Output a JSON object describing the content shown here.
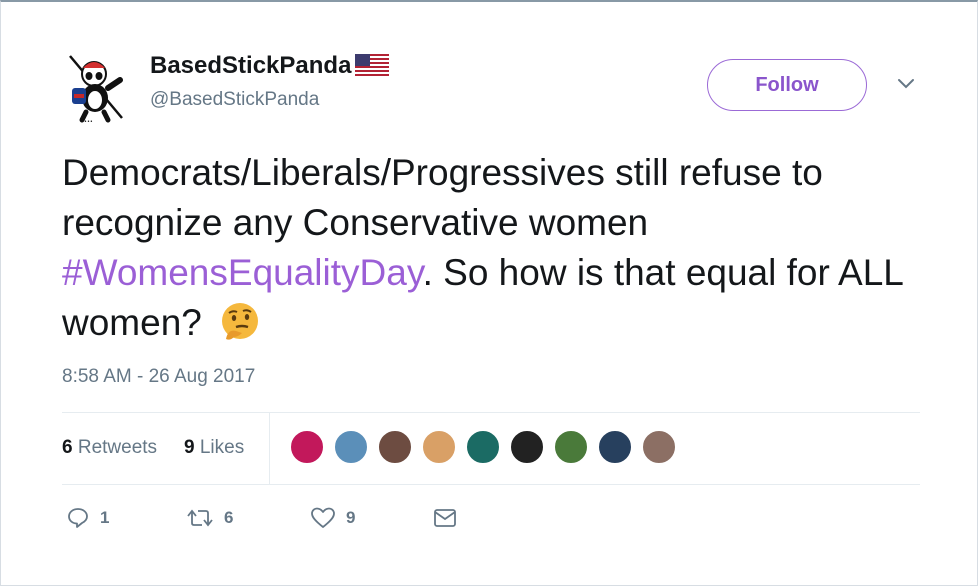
{
  "user": {
    "display_name": "BasedStickPanda",
    "handle": "@BasedStickPanda"
  },
  "follow_label": "Follow",
  "tweet": {
    "text_part1": "Democrats/Liberals/Progressives still refuse to recognize any Conservative women ",
    "hashtag": "#WomensEqualityDay",
    "text_part2": ". So how is that equal for ALL women?",
    "emoji": "thinking-face"
  },
  "timestamp": "8:58 AM - 26 Aug 2017",
  "stats": {
    "retweets_count": "6",
    "retweets_label": "Retweets",
    "likes_count": "9",
    "likes_label": "Likes"
  },
  "liker_avatars": [
    {
      "color": "#c2185b"
    },
    {
      "color": "#5b8fb9"
    },
    {
      "color": "#6d4c41"
    },
    {
      "color": "#d9a066"
    },
    {
      "color": "#1b6b64"
    },
    {
      "color": "#222222"
    },
    {
      "color": "#4a7a3a"
    },
    {
      "color": "#27405e"
    },
    {
      "color": "#8c6f64"
    }
  ],
  "actions": {
    "reply_count": "1",
    "retweet_count": "6",
    "like_count": "9"
  },
  "colors": {
    "accent": "#9b5fd6",
    "text": "#14171a",
    "muted": "#657786"
  }
}
